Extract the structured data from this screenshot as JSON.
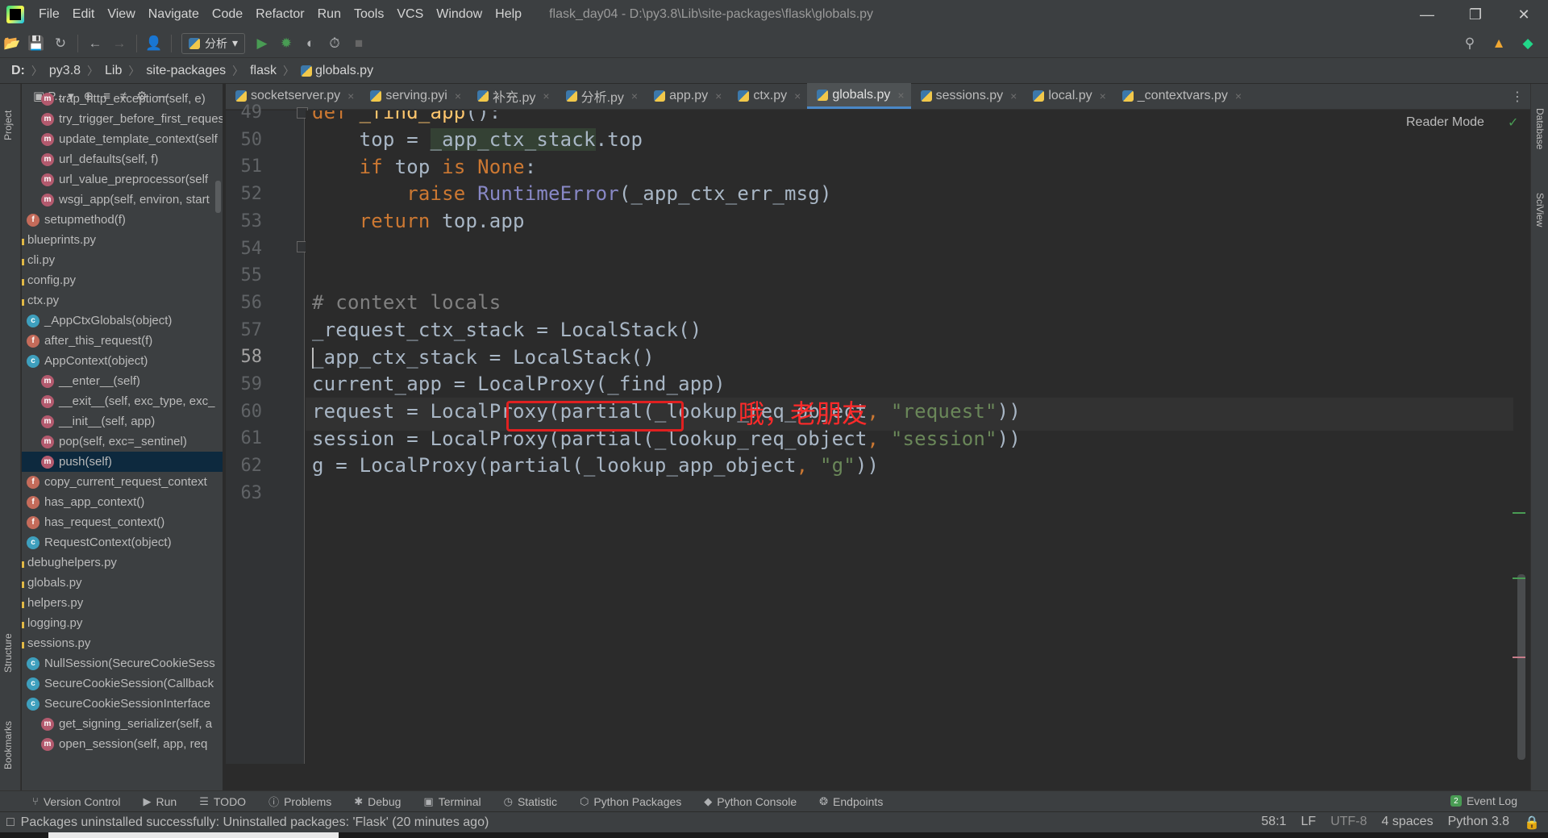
{
  "menu": {
    "items": [
      "File",
      "Edit",
      "View",
      "Navigate",
      "Code",
      "Refactor",
      "Run",
      "Tools",
      "VCS",
      "Window",
      "Help"
    ],
    "window_title": "flask_day04 - D:\\py3.8\\Lib\\site-packages\\flask\\globals.py"
  },
  "toolbar": {
    "run_config": "分析"
  },
  "breadcrumb": [
    "D:",
    "py3.8",
    "Lib",
    "site-packages",
    "flask",
    "globals.py"
  ],
  "side_strips": {
    "left": [
      "Project",
      "Structure",
      "Bookmarks"
    ],
    "right": [
      "Database",
      "SciView"
    ]
  },
  "project_panel": {
    "title": "P...",
    "tree": [
      {
        "icon": "m",
        "label": "trap_http_exception(self, e)",
        "indent": 2
      },
      {
        "icon": "m",
        "label": "try_trigger_before_first_request",
        "indent": 2
      },
      {
        "icon": "m",
        "label": "update_template_context(self",
        "indent": 2
      },
      {
        "icon": "m",
        "label": "url_defaults(self, f)",
        "indent": 2
      },
      {
        "icon": "m",
        "label": "url_value_preprocessor(self",
        "indent": 2
      },
      {
        "icon": "m",
        "label": "wsgi_app(self, environ, start",
        "indent": 2
      },
      {
        "icon": "f",
        "label": "setupmethod(f)",
        "indent": 1
      },
      {
        "icon": "file",
        "label": "blueprints.py",
        "indent": 0
      },
      {
        "icon": "file",
        "label": "cli.py",
        "indent": 0
      },
      {
        "icon": "file",
        "label": "config.py",
        "indent": 0
      },
      {
        "icon": "file",
        "label": "ctx.py",
        "indent": 0
      },
      {
        "icon": "c",
        "label": "_AppCtxGlobals(object)",
        "indent": 1
      },
      {
        "icon": "f",
        "label": "after_this_request(f)",
        "indent": 1
      },
      {
        "icon": "c",
        "label": "AppContext(object)",
        "indent": 1
      },
      {
        "icon": "m",
        "label": "__enter__(self)",
        "indent": 2
      },
      {
        "icon": "m",
        "label": "__exit__(self, exc_type, exc_",
        "indent": 2
      },
      {
        "icon": "m",
        "label": "__init__(self, app)",
        "indent": 2
      },
      {
        "icon": "m",
        "label": "pop(self, exc=_sentinel)",
        "indent": 2
      },
      {
        "icon": "m",
        "label": "push(self)",
        "indent": 2,
        "selected": true
      },
      {
        "icon": "f",
        "label": "copy_current_request_context",
        "indent": 1
      },
      {
        "icon": "f",
        "label": "has_app_context()",
        "indent": 1
      },
      {
        "icon": "f",
        "label": "has_request_context()",
        "indent": 1
      },
      {
        "icon": "c",
        "label": "RequestContext(object)",
        "indent": 1
      },
      {
        "icon": "file",
        "label": "debughelpers.py",
        "indent": 0
      },
      {
        "icon": "file",
        "label": "globals.py",
        "indent": 0
      },
      {
        "icon": "file",
        "label": "helpers.py",
        "indent": 0
      },
      {
        "icon": "file",
        "label": "logging.py",
        "indent": 0
      },
      {
        "icon": "file",
        "label": "sessions.py",
        "indent": 0
      },
      {
        "icon": "c",
        "label": "NullSession(SecureCookieSess",
        "indent": 1
      },
      {
        "icon": "c",
        "label": "SecureCookieSession(Callback",
        "indent": 1
      },
      {
        "icon": "c",
        "label": "SecureCookieSessionInterface",
        "indent": 1
      },
      {
        "icon": "m",
        "label": "get_signing_serializer(self, a",
        "indent": 2
      },
      {
        "icon": "m",
        "label": "open_session(self, app, req",
        "indent": 2
      }
    ]
  },
  "tabs": [
    {
      "label": "socketserver.py",
      "active": false
    },
    {
      "label": "serving.pyi",
      "active": false
    },
    {
      "label": "补充.py",
      "active": false
    },
    {
      "label": "分析.py",
      "active": false
    },
    {
      "label": "app.py",
      "active": false
    },
    {
      "label": "ctx.py",
      "active": false
    },
    {
      "label": "globals.py",
      "active": true
    },
    {
      "label": "sessions.py",
      "active": false
    },
    {
      "label": "local.py",
      "active": false
    },
    {
      "label": "_contextvars.py",
      "active": false
    }
  ],
  "editor": {
    "reader_mode": "Reader Mode",
    "line_numbers": [
      "49",
      "50",
      "51",
      "52",
      "53",
      "54",
      "55",
      "56",
      "57",
      "58",
      "59",
      "60",
      "61",
      "62",
      "63"
    ],
    "current_line": "58",
    "annotation": "哦，老朋友"
  },
  "bottom_tools": [
    {
      "icon": "branch-icon",
      "label": "Version Control"
    },
    {
      "icon": "play-icon",
      "label": "Run"
    },
    {
      "icon": "list-icon",
      "label": "TODO"
    },
    {
      "icon": "info-icon",
      "label": "Problems"
    },
    {
      "icon": "bug-icon",
      "label": "Debug"
    },
    {
      "icon": "terminal-icon",
      "label": "Terminal"
    },
    {
      "icon": "clock-icon",
      "label": "Statistic"
    },
    {
      "icon": "package-icon",
      "label": "Python Packages"
    },
    {
      "icon": "python-icon",
      "label": "Python Console"
    },
    {
      "icon": "endpoints-icon",
      "label": "Endpoints"
    }
  ],
  "event_log": {
    "badge": "2",
    "label": "Event Log"
  },
  "status": {
    "message": "Packages uninstalled successfully: Uninstalled packages: 'Flask' (20 minutes ago)",
    "position": "58:1",
    "line_sep": "LF",
    "encoding": "UTF-8",
    "indent": "4 spaces",
    "interpreter": "Python 3.8"
  }
}
